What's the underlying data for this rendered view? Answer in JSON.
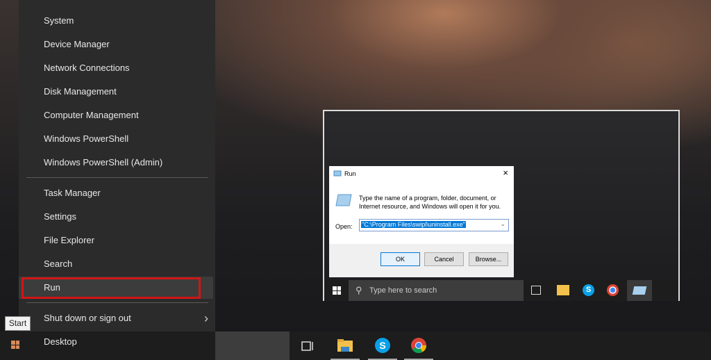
{
  "menu": {
    "items_top": [
      "System",
      "Device Manager",
      "Network Connections",
      "Disk Management",
      "Computer Management",
      "Windows PowerShell",
      "Windows PowerShell (Admin)"
    ],
    "items_mid": [
      "Task Manager",
      "Settings",
      "File Explorer",
      "Search",
      "Run"
    ],
    "shutdown": "Shut down or sign out",
    "desktop": "Desktop"
  },
  "tooltip": "Start",
  "run_dialog": {
    "title": "Run",
    "description_line1": "Type the name of a program, folder, document, or",
    "description_line2": "Internet resource, and Windows will open it for you.",
    "open_label": "Open:",
    "open_value": "\"C:\\Program Files\\swipl\\uninstall.exe\"",
    "ok": "OK",
    "cancel": "Cancel",
    "browse": "Browse..."
  },
  "inner_taskbar": {
    "search_placeholder": "Type here to search"
  },
  "colors": {
    "highlight": "#d01616",
    "selection": "#0078d7"
  }
}
